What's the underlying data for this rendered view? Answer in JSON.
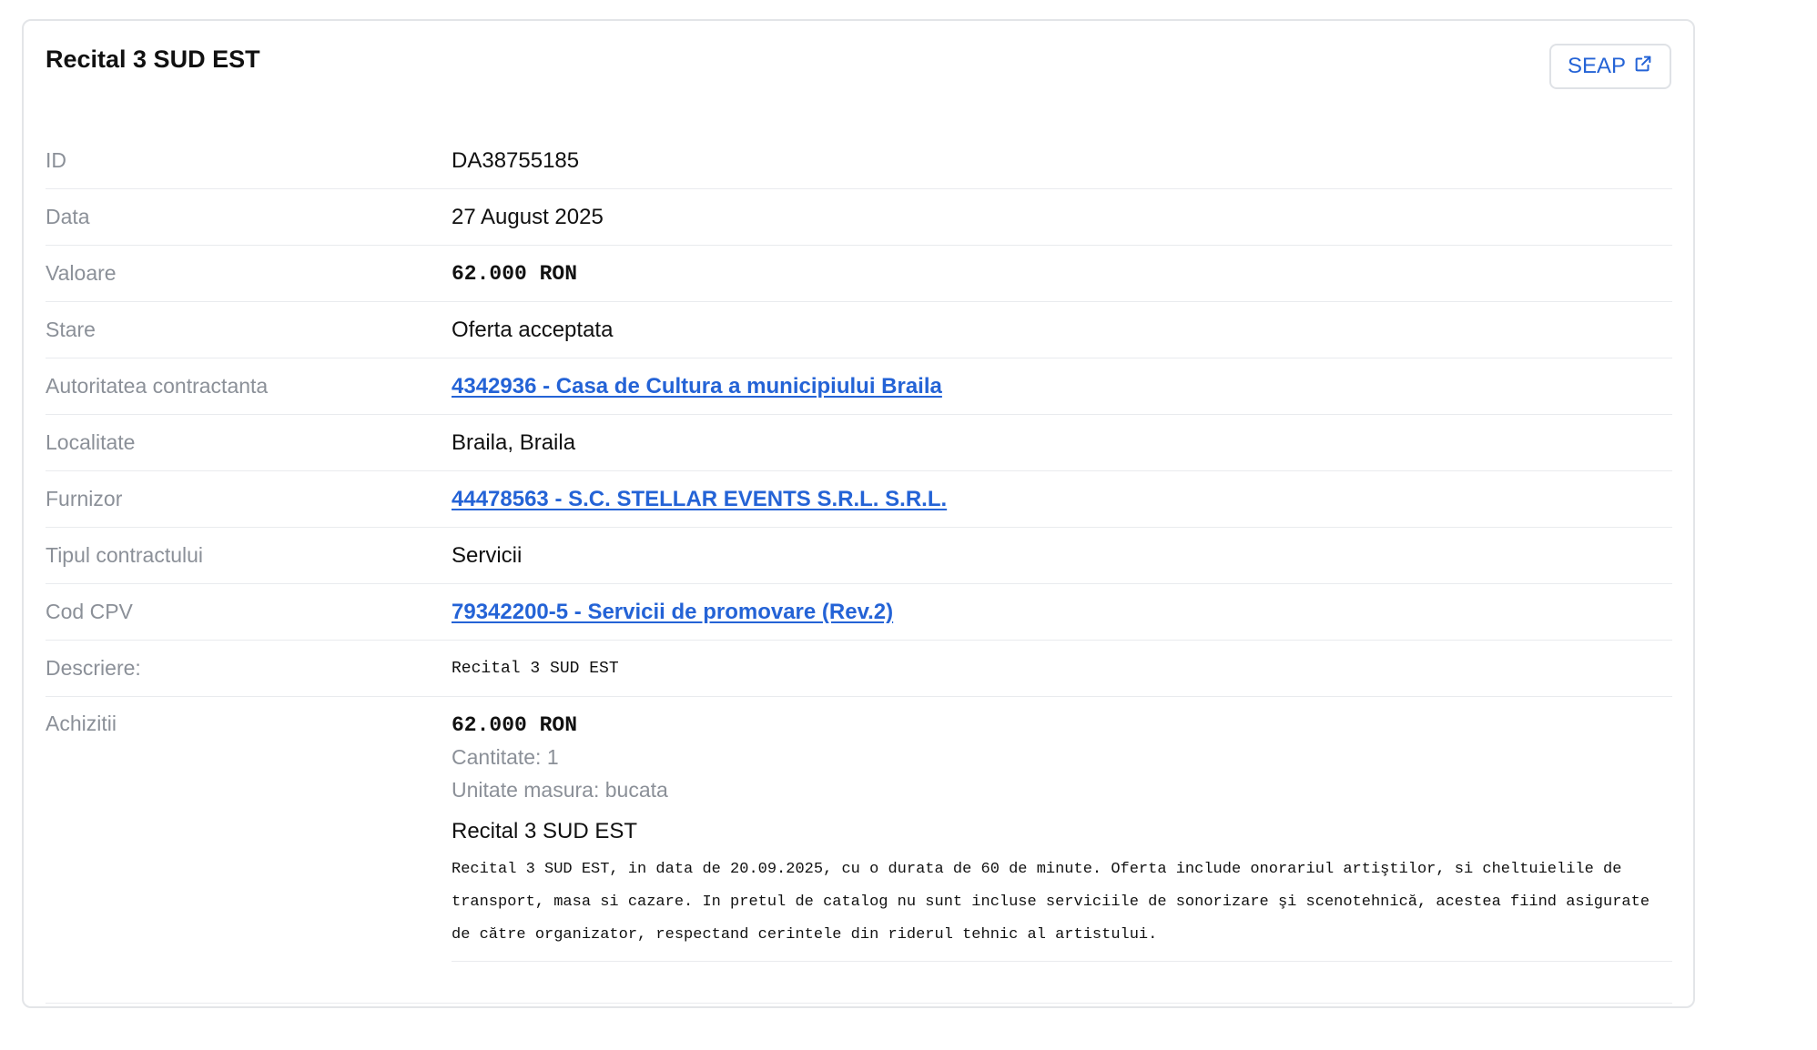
{
  "card": {
    "title": "Recital 3 SUD EST",
    "seap_button_label": "SEAP"
  },
  "fields": {
    "id": {
      "label": "ID",
      "value": "DA38755185"
    },
    "data": {
      "label": "Data",
      "value": "27 August 2025"
    },
    "valoare": {
      "label": "Valoare",
      "value": "62.000 RON"
    },
    "stare": {
      "label": "Stare",
      "value": "Oferta acceptata"
    },
    "autoritate": {
      "label": "Autoritatea contractanta",
      "value": "4342936 - Casa de Cultura a municipiului Braila"
    },
    "localitate": {
      "label": "Localitate",
      "value": "Braila, Braila"
    },
    "furnizor": {
      "label": "Furnizor",
      "value": "44478563 - S.C. STELLAR EVENTS S.R.L. S.R.L."
    },
    "tip_contract": {
      "label": "Tipul contractului",
      "value": "Servicii"
    },
    "cod_cpv": {
      "label": "Cod CPV",
      "value": "79342200-5 - Servicii de promovare (Rev.2)"
    },
    "descriere": {
      "label": "Descriere:",
      "value": "Recital 3 SUD EST"
    }
  },
  "achizitii": {
    "label": "Achizitii",
    "items": [
      {
        "price": "62.000 RON",
        "cantitate": "Cantitate: 1",
        "unitate": "Unitate masura: bucata",
        "title": "Recital 3 SUD EST",
        "description": "Recital 3 SUD EST, in data de 20.09.2025, cu o durata de 60 de minute. Oferta include onorariul artiştilor, si cheltuielile de transport, masa si cazare. In pretul de catalog nu sunt incluse serviciile de sonorizare şi scenotehnică, acestea fiind asigurate de către organizator, respectand cerintele din riderul tehnic al artistului."
      }
    ]
  },
  "colors": {
    "link": "#2463d6",
    "label": "#8b9098",
    "border": "#e3e5e8"
  },
  "icons": {
    "seap": "external-link-icon"
  }
}
